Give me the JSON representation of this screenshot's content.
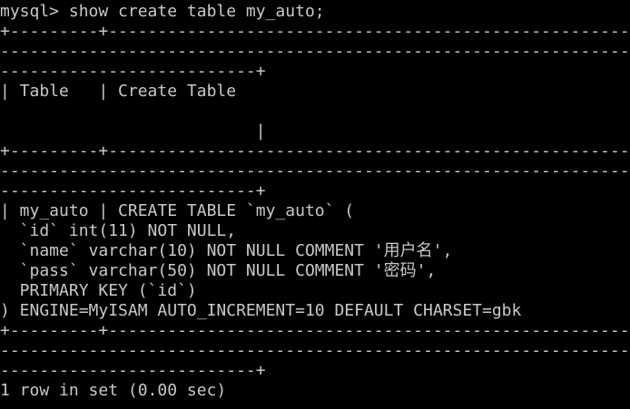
{
  "terminal": {
    "text_color": "#c8c8c8",
    "background_color": "#000000",
    "lines": [
      "mysql> show create table my_auto;",
      "+---------+-------------------------------------------------------",
      "------------------------------------------------------------------",
      "--------------------------+",
      "| Table   | Create Table",
      "                          |",
      "+---------+-------------------------------------------------------",
      "------------------------------------------------------------------",
      "--------------------------+",
      "| my_auto | CREATE TABLE `my_auto` (",
      "  `id` int(11) NOT NULL,",
      "  `name` varchar(10) NOT NULL COMMENT '用户名',",
      "  `pass` varchar(50) NOT NULL COMMENT '密码',",
      "  PRIMARY KEY (`id`)",
      ") ENGINE=MyISAM AUTO_INCREMENT=10 DEFAULT CHARSET=gbk",
      "+---------+-------------------------------------------------------",
      "------------------------------------------------------------------",
      "--------------------------+",
      "1 row in set (0.00 sec)"
    ]
  }
}
